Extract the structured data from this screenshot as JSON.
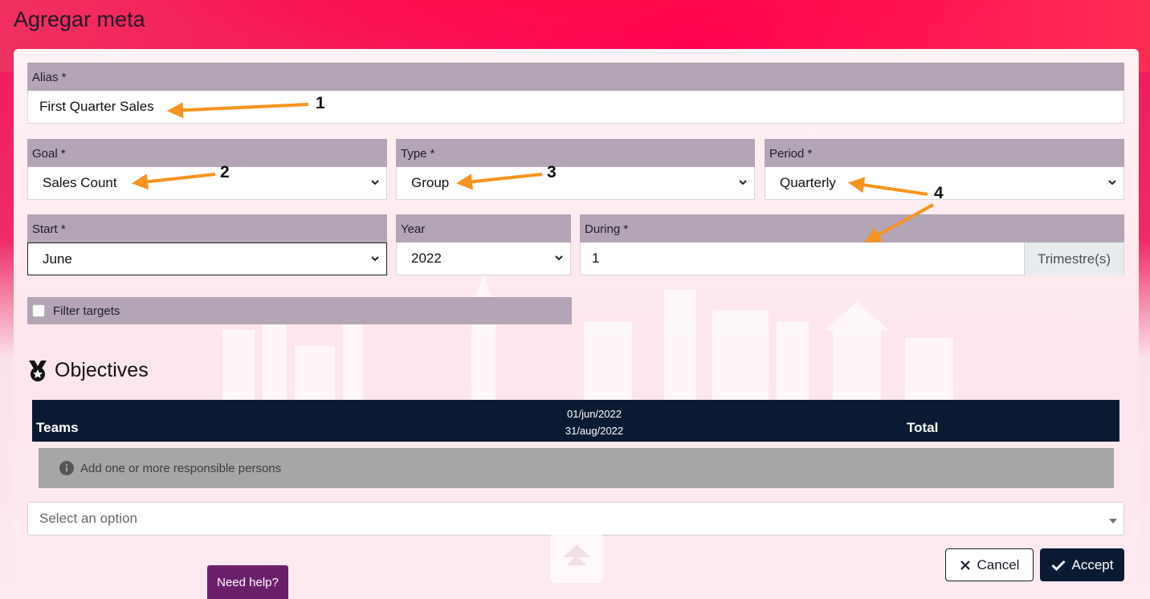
{
  "title": "Agregar meta",
  "form": {
    "alias": {
      "label": "Alias *",
      "value": "First Quarter Sales"
    },
    "goal": {
      "label": "Goal *",
      "value": "Sales Count"
    },
    "type": {
      "label": "Type *",
      "value": "Group"
    },
    "period": {
      "label": "Period *",
      "value": "Quarterly"
    },
    "start": {
      "label": "Start *",
      "value": "June"
    },
    "year": {
      "label": "Year",
      "value": "2022"
    },
    "during": {
      "label": "During *",
      "value": "1",
      "addon": "Trimestre(s)"
    },
    "filter": {
      "label": "Filter targets",
      "checked": false
    }
  },
  "objectives": {
    "heading": "Objectives",
    "columns": {
      "teams": "Teams",
      "date_start": "01/jun/2022",
      "date_end": "31/aug/2022",
      "total": "Total"
    },
    "info_message": "Add one or more responsible persons",
    "select_placeholder": "Select an option"
  },
  "buttons": {
    "cancel": "Cancel",
    "accept": "Accept",
    "help": "Need help?"
  },
  "annotations": {
    "n1": "1",
    "n2": "2",
    "n3": "3",
    "n4": "4"
  },
  "colors": {
    "accent_dark": "#0b1a33",
    "label_bar": "#b4a5b6",
    "arrow": "#f7941d",
    "help": "#6b1f6b"
  },
  "icons": [
    "chevron-down-icon",
    "medal-icon",
    "info-icon",
    "x-icon",
    "check-icon",
    "arrow-up-icon"
  ]
}
